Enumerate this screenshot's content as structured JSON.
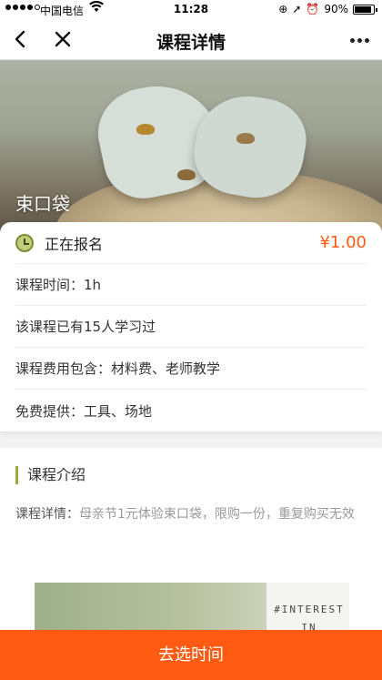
{
  "status_bar": {
    "carrier": "中国电信",
    "time": "11:28",
    "battery": "90%"
  },
  "nav": {
    "title": "课程详情"
  },
  "hero": {
    "title": "束口袋"
  },
  "info": {
    "status": "正在报名",
    "price": "¥1.00",
    "duration": "课程时间：1h",
    "participants": "该课程已有15人学习过",
    "fee_includes": "课程费用包含：材料费、老师教学",
    "free_provided": "免费提供：工具、场地"
  },
  "intro": {
    "heading": "课程介绍",
    "detail_label": "课程详情：",
    "detail_text": "母亲节1元体验束口袋，限购一份，重复购买无效",
    "photo_tag_line1": "#INTEREST",
    "photo_tag_line2": "IN"
  },
  "cta": {
    "label": "去选时间"
  },
  "colors": {
    "accent": "#ff5a12",
    "section_bar": "#9caa3c"
  },
  "icons": [
    "back-icon",
    "close-icon",
    "more-icon",
    "clock-icon",
    "wifi-icon",
    "alarm-icon",
    "battery-icon"
  ]
}
